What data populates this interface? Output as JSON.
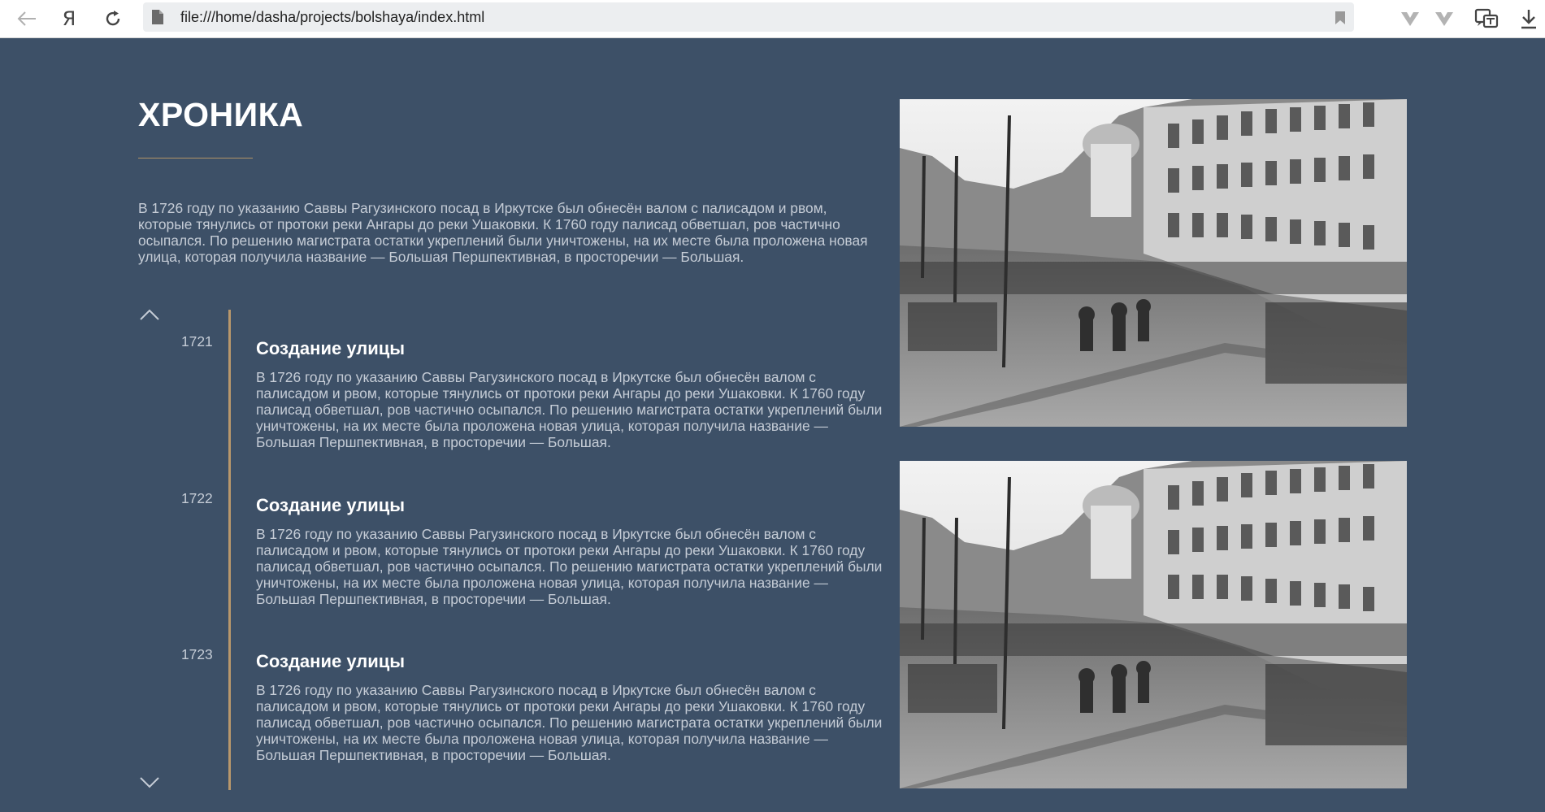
{
  "browser": {
    "url": "file:///home/dasha/projects/bolshaya/index.html",
    "ya_logo": "Я",
    "icons": [
      "back-arrow-icon",
      "yandex-logo-icon",
      "reload-icon",
      "file-icon",
      "bookmark-icon",
      "extension-v-icon",
      "extension-v-icon",
      "translate-icon",
      "download-icon"
    ]
  },
  "page": {
    "title": "ХРОНИКА",
    "intro": "В 1726 году по указанию Саввы Рагузинского посад в Иркутске был обнесён валом с палисадом и рвом, которые тянулись от протоки реки Ангары до реки Ушаковки. К 1760 году палисад обветшал, ров частично осыпался. По решению магистрата остатки укреплений были уничтожены, на их месте была проложена новая улица, которая получила название — Большая Першпективная, в просторечии — Большая."
  },
  "timeline": {
    "events": [
      {
        "year": "1721",
        "title": "Создание улицы",
        "text": "В 1726 году по указанию Саввы Рагузинского посад в Иркутске был обнесён валом с палисадом и рвом, которые тянулись от протоки реки Ангары до реки Ушаковки. К 1760 году палисад обветшал, ров частично осыпался. По решению магистрата остатки укреплений были уничтожены, на их месте была проложена новая улица, которая получила название — Большая Першпективная, в просторечии — Большая."
      },
      {
        "year": "1722",
        "title": "Создание улицы",
        "text": "В 1726 году по указанию Саввы Рагузинского посад в Иркутске был обнесён валом с палисадом и рвом, которые тянулись от протоки реки Ангары до реки Ушаковки. К 1760 году палисад обветшал, ров частично осыпался. По решению магистрата остатки укреплений были уничтожены, на их месте была проложена новая улица, которая получила название — Большая Першпективная, в просторечии — Большая."
      },
      {
        "year": "1723",
        "title": "Создание улицы",
        "text": "В 1726 году по указанию Саввы Рагузинского посад в Иркутске был обнесён валом с палисадом и рвом, которые тянулись от протоки реки Ангары до реки Ушаковки. К 1760 году палисад обветшал, ров частично осыпался. По решению магистрата остатки укреплений были уничтожены, на их месте была проложена новая улица, которая получила название — Большая Першпективная, в просторечии — Большая."
      }
    ]
  },
  "colors": {
    "background": "#3d5067",
    "accent": "#b8976b",
    "text_muted": "#c5ccd6",
    "text_white": "#ffffff"
  }
}
